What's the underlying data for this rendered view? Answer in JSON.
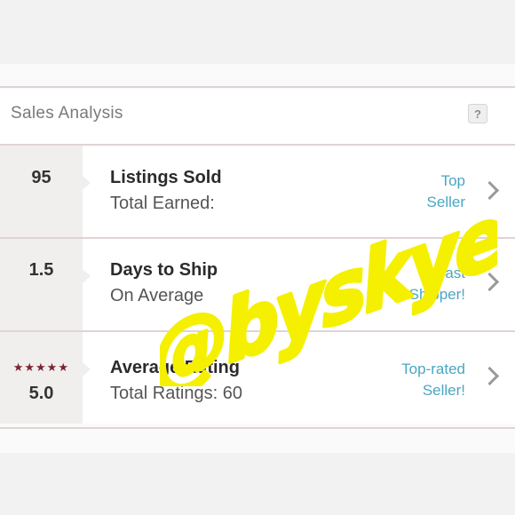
{
  "header": {
    "title": "Sales Analysis",
    "help_label": "?"
  },
  "rows": [
    {
      "stat": "95",
      "title": "Listings Sold",
      "subtitle": "Total Earned:",
      "badge_line1": "Top",
      "badge_line2": "Seller"
    },
    {
      "stat": "1.5",
      "title": "Days to Ship",
      "subtitle": "On Average",
      "badge_line1": "Fast",
      "badge_line2": "Shipper!"
    },
    {
      "stat": "5.0",
      "stars": "★★★★★",
      "title": "Average Rating",
      "subtitle": "Total Ratings: 60",
      "badge_line1": "Top-rated",
      "badge_line2": "Seller!"
    }
  ],
  "watermark": {
    "text": "@byskye"
  },
  "colors": {
    "accent": "#4ba6c2",
    "star": "#7d2333",
    "watermark": "#f4f000"
  },
  "icons": {
    "help": "question-mark-icon",
    "chevron": "chevron-right-icon",
    "star": "star-icon"
  }
}
